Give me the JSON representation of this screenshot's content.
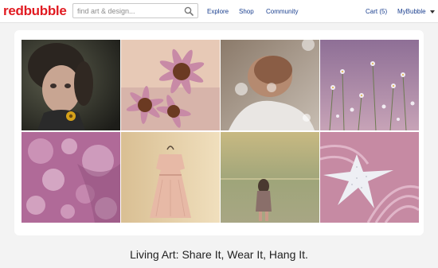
{
  "brand": {
    "part1": "red",
    "part2": "bubble"
  },
  "search": {
    "placeholder": "find art & design..."
  },
  "nav": {
    "explore": "Explore",
    "shop": "Shop",
    "community": "Community",
    "cart": "Cart (5)",
    "account": "MyBubble"
  },
  "colors": {
    "brand_red": "#e11b22",
    "link_blue": "#1a3f8f"
  },
  "tagline": "Living Art: Share It, Wear It, Hang It."
}
